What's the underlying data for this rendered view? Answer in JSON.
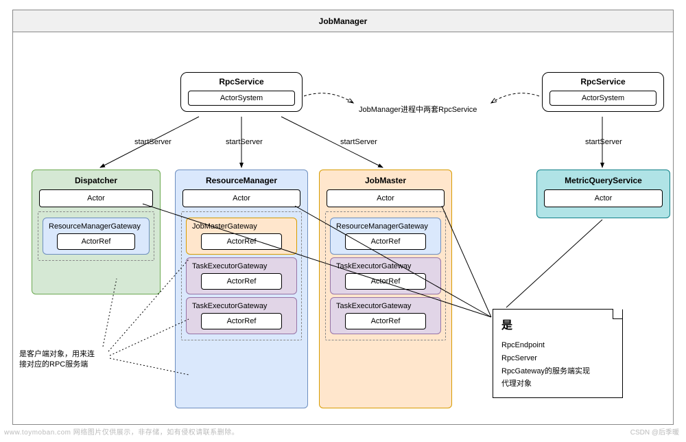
{
  "header": {
    "title": "JobManager"
  },
  "rpcService1": {
    "title": "RpcService",
    "inner": "ActorSystem"
  },
  "rpcService2": {
    "title": "RpcService",
    "inner": "ActorSystem"
  },
  "midNote": "JobManager进程中两套RpcService",
  "labels": {
    "startServer1": "startServer",
    "startServer2": "startServer",
    "startServer3": "startServer",
    "startServer4": "startServer"
  },
  "dispatcher": {
    "title": "Dispatcher",
    "actor": "Actor",
    "gateway": {
      "title": "ResourceManagerGateway",
      "ref": "ActorRef"
    }
  },
  "resourceManager": {
    "title": "ResourceManager",
    "actor": "Actor",
    "g1": {
      "title": "JobMasterGateway",
      "ref": "ActorRef"
    },
    "g2": {
      "title": "TaskExecutorGateway",
      "ref": "ActorRef"
    },
    "g3": {
      "title": "TaskExecutorGateway",
      "ref": "ActorRef"
    }
  },
  "jobMaster": {
    "title": "JobMaster",
    "actor": "Actor",
    "g1": {
      "title": "ResourceManagerGateway",
      "ref": "ActorRef"
    },
    "g2": {
      "title": "TaskExecutorGateway",
      "ref": "ActorRef"
    },
    "g3": {
      "title": "TaskExecutorGateway",
      "ref": "ActorRef"
    }
  },
  "metricQuery": {
    "title": "MetricQueryService",
    "actor": "Actor"
  },
  "note": {
    "head": "是",
    "l1": "RpcEndpoint",
    "l2": "RpcServer",
    "l3": "RpcGateway的服务端实现",
    "l4": "代理对象"
  },
  "caption": {
    "l1": "是客户端对象，用来连",
    "l2": "接对应的RPC服务端"
  },
  "footer": {
    "left": "www.toymoban.com 网络图片仅供展示，非存储，如有侵权请联系删除。",
    "right": "CSDN @后季暖"
  }
}
